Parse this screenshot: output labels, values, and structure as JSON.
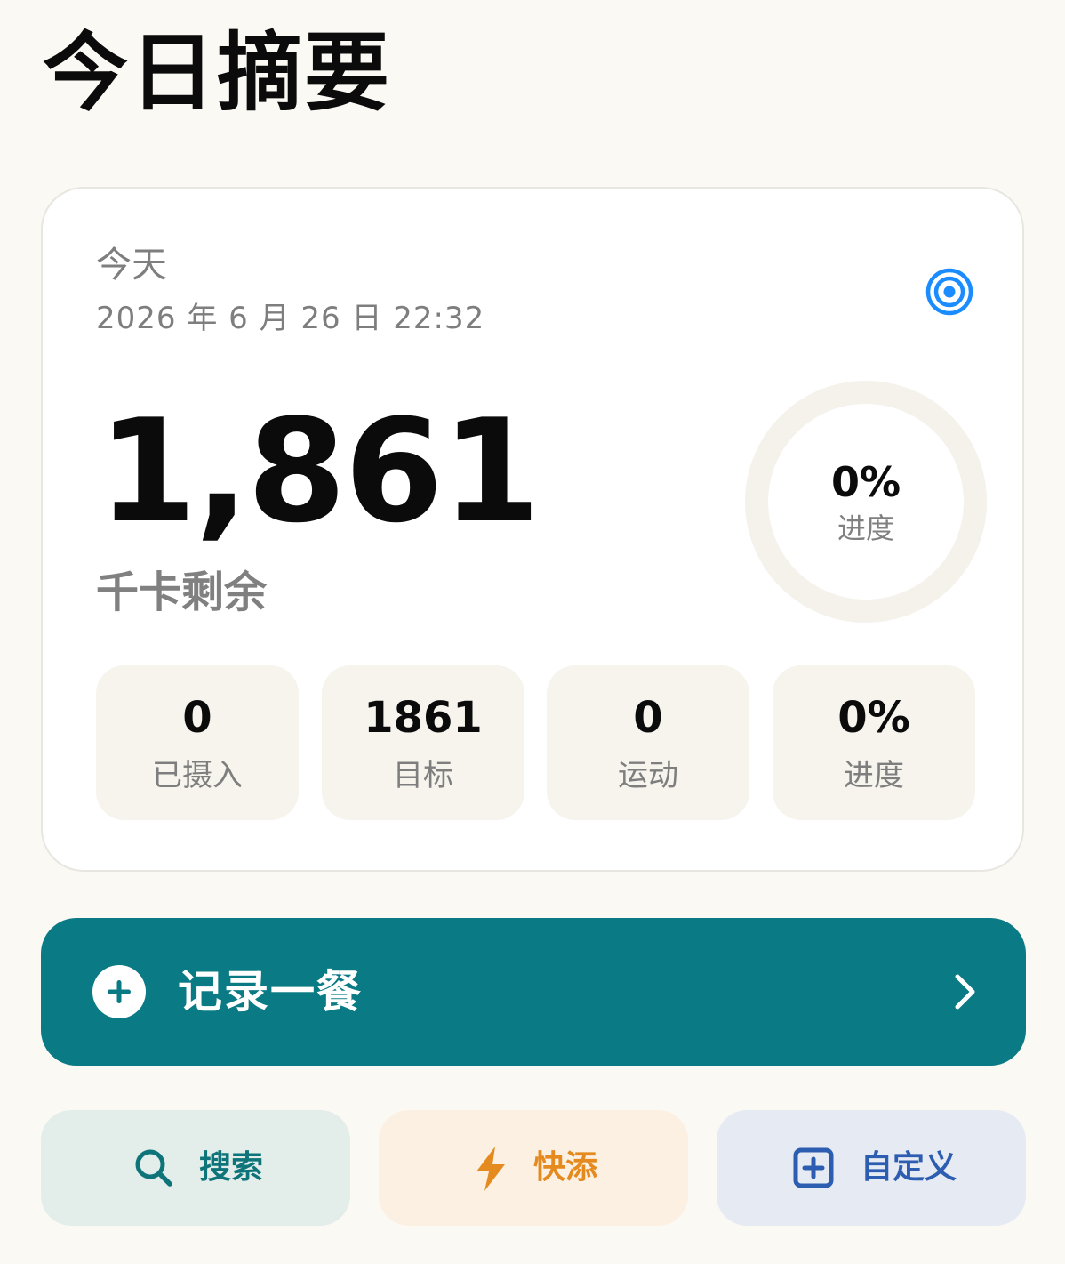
{
  "page": {
    "title": "今日摘要"
  },
  "summary": {
    "day_label": "今天",
    "datetime": "2026 年 6 月 26 日 22:32",
    "remaining_value": "1,861",
    "remaining_caption": "千卡剩余",
    "progress_value": "0%",
    "progress_label": "进度",
    "progress_fraction": 0,
    "target_icon": "target-icon",
    "stats": [
      {
        "value": "0",
        "label": "已摄入"
      },
      {
        "value": "1861",
        "label": "目标"
      },
      {
        "value": "0",
        "label": "运动"
      },
      {
        "value": "0%",
        "label": "进度"
      }
    ]
  },
  "log_meal": {
    "label": "记录一餐",
    "icon": "plus-circle-icon",
    "trailing_icon": "chevron-right-icon"
  },
  "actions": [
    {
      "label": "搜索",
      "icon": "search-icon"
    },
    {
      "label": "快添",
      "icon": "lightning-icon"
    },
    {
      "label": "自定义",
      "icon": "plus-square-icon"
    }
  ],
  "colors": {
    "background": "#FBF9F4",
    "card": "#FFFFFF",
    "accent_teal": "#0A7A84",
    "accent_blue": "#1A8CFF",
    "ring_track": "#F5F1EB",
    "stat_tile": "#F7F4EE",
    "search_bg": "#E3EEEB",
    "search_fg": "#0E7479",
    "quick_bg": "#FCF0E3",
    "quick_fg": "#E48A1E",
    "custom_bg": "#E6EBF3",
    "custom_fg": "#2D5DB0"
  }
}
